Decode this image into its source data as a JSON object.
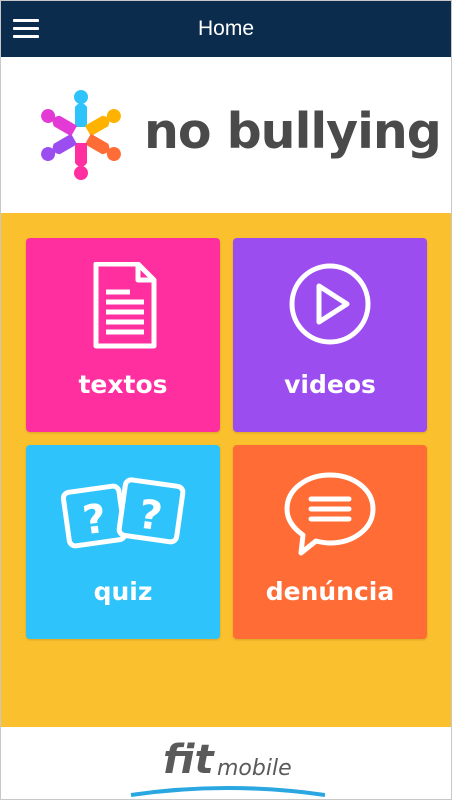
{
  "header": {
    "title": "Home",
    "menu_icon": "hamburger-menu-icon",
    "background": "#0c2c4e"
  },
  "brand": {
    "logo_text": "no bullying",
    "logo_icon": "hands-circle-icon"
  },
  "tiles": [
    {
      "label": "textos",
      "icon": "document-icon",
      "color": "#ff2fa0"
    },
    {
      "label": "videos",
      "icon": "play-circle-icon",
      "color": "#9b4df0"
    },
    {
      "label": "quiz",
      "icon": "question-cards-icon",
      "color": "#2ec4fb"
    },
    {
      "label": "denúncia",
      "icon": "chat-bubble-icon",
      "color": "#ff6c36"
    }
  ],
  "background": "#fbc02d",
  "footer": {
    "brand_fit": "fit",
    "brand_mobile": "mobile"
  }
}
